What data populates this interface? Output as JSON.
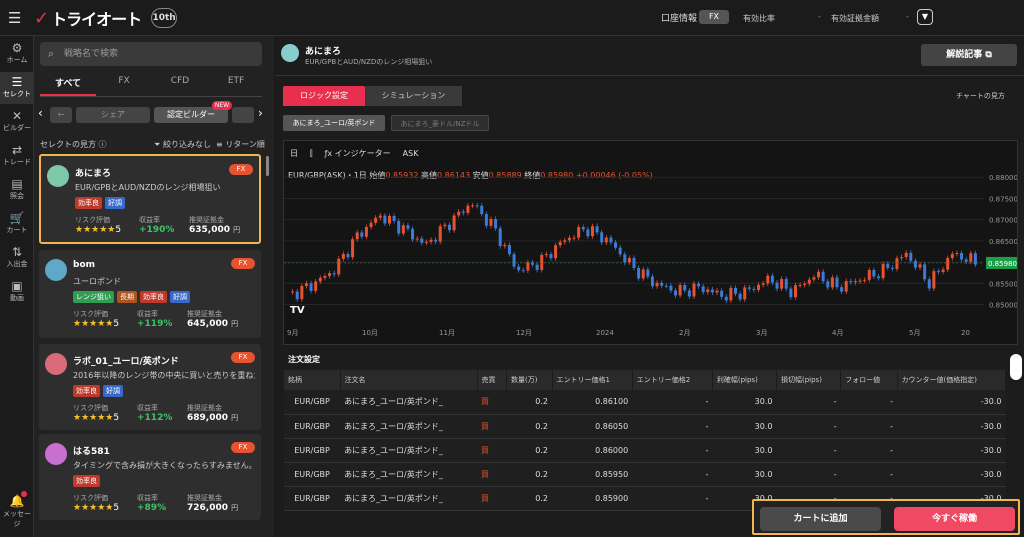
{
  "topbar": {
    "menu_icon": "hamburger-icon",
    "brand": "トライオート",
    "anniversary": "10th",
    "account_info": "口座情報",
    "account_type": "FX",
    "effective_ratio_label": "有効比率",
    "effective_ratio_sep": "-",
    "effective_margin_label": "有効証拠金額",
    "effective_margin_sep": "-"
  },
  "nav": [
    {
      "label": "ホーム",
      "icon": "gear-icon"
    },
    {
      "label": "セレクト",
      "icon": "stack-icon"
    },
    {
      "label": "ビルダー",
      "icon": "tools-icon"
    },
    {
      "label": "トレード",
      "icon": "trade-icon"
    },
    {
      "label": "照会",
      "icon": "list-icon"
    },
    {
      "label": "カート",
      "icon": "cart-icon"
    },
    {
      "label": "入出金",
      "icon": "transfer-icon"
    },
    {
      "label": "動画",
      "icon": "video-icon"
    }
  ],
  "messages": {
    "label": "メッセージ"
  },
  "sidebar": {
    "search_placeholder": "戦略名で検索",
    "tabs": [
      "すべて",
      "FX",
      "CFD",
      "ETF"
    ],
    "chips": [
      "シェア",
      "認定ビルダー"
    ],
    "chip_new": "NEW",
    "select_how": "セレクトの見方",
    "filter": "絞り込みなし",
    "sort": "リターン順"
  },
  "cards": [
    {
      "name": "あにまろ",
      "badge": "FX",
      "desc": "EUR/GPBとAUD/NZDのレンジ相場狙い",
      "tags": [
        "効率良",
        "好調"
      ],
      "risk_label": "リスク評価",
      "stars": "★★★★★",
      "risk": "5",
      "gain_label": "収益率",
      "gain": "+190%",
      "margin_label": "推奨証拠金",
      "margin": "635,000",
      "unit": "円"
    },
    {
      "name": "bom",
      "badge": "FX",
      "desc": "ユーロポンド",
      "tags": [
        "レンジ狙い",
        "長期",
        "効率良",
        "好調"
      ],
      "risk_label": "リスク評価",
      "stars": "★★★★★",
      "risk": "5",
      "gain_label": "収益率",
      "gain": "+119%",
      "margin_label": "推奨証拠金",
      "margin": "645,000",
      "unit": "円"
    },
    {
      "name": "ラボ_01_ユーロ/英ポンド",
      "badge": "FX",
      "desc": "2016年以降のレンジ帯の中央に買いと売りを重ねた設...",
      "tags": [
        "効率良",
        "好調"
      ],
      "risk_label": "リスク評価",
      "stars": "★★★★★",
      "risk": "5",
      "gain_label": "収益率",
      "gain": "+112%",
      "margin_label": "推奨証拠金",
      "margin": "689,000",
      "unit": "円"
    },
    {
      "name": "はる581",
      "badge": "FX",
      "desc": "タイミングで含み損が大きくなったらすみません。よ...",
      "tags": [
        "効率良"
      ],
      "risk_label": "リスク評価",
      "stars": "★★★★★",
      "risk": "5",
      "gain_label": "収益率",
      "gain": "+89%",
      "margin_label": "推奨証拠金",
      "margin": "726,000",
      "unit": "円"
    }
  ],
  "main": {
    "name": "あにまろ",
    "desc": "EUR/GPBとAUD/NZDのレンジ相場狙い",
    "explain_btn": "解説記事",
    "tab_logic": "ロジック設定",
    "tab_sim": "シミュレーション",
    "chart_how": "チャートの見方",
    "strategy1": "あにまろ_ユーロ/英ポンド",
    "strategy2": "あにまろ_豪ドル/NZドル",
    "tools": {
      "interval": "日",
      "indicator": "インジケーター",
      "side": "ASK"
    },
    "legend": {
      "symbol": "EUR/GBP(ASK)・1日",
      "o_label": "始値",
      "o": "0.85932",
      "h_label": "高値",
      "h": "0.86143",
      "l_label": "安値",
      "l": "0.85889",
      "c_label": "終値",
      "c": "0.85980",
      "chg": "+0.00046 (-0.05%)"
    },
    "order_title": "注文設定",
    "order_headers": [
      "銘柄",
      "注文名",
      "売買",
      "数量(万)",
      "エントリー価格1",
      "エントリー価格2",
      "利確幅(pips)",
      "損切幅(pips)",
      "フォロー値",
      "カウンター値(価格指定)"
    ],
    "order_rows": [
      [
        "EUR/GBP",
        "あにまろ_ユーロ/英ポンド_",
        "買",
        "0.2",
        "0.86100",
        "-",
        "30.0",
        "-",
        "-",
        "-30.0"
      ],
      [
        "EUR/GBP",
        "あにまろ_ユーロ/英ポンド_",
        "買",
        "0.2",
        "0.86050",
        "-",
        "30.0",
        "-",
        "-",
        "-30.0"
      ],
      [
        "EUR/GBP",
        "あにまろ_ユーロ/英ポンド_",
        "買",
        "0.2",
        "0.86000",
        "-",
        "30.0",
        "-",
        "-",
        "-30.0"
      ],
      [
        "EUR/GBP",
        "あにまろ_ユーロ/英ポンド_",
        "買",
        "0.2",
        "0.85950",
        "-",
        "30.0",
        "-",
        "-",
        "-30.0"
      ],
      [
        "EUR/GBP",
        "あにまろ_ユーロ/英ポンド_",
        "買",
        "0.2",
        "0.85900",
        "-",
        "30.0",
        "-",
        "-",
        "-30.0"
      ]
    ],
    "cart_btn": "カートに追加",
    "run_btn": "今すぐ稼働"
  },
  "colors": {
    "accent": "#e8304e",
    "up": "#e85230",
    "down": "#3d7bd9",
    "gain": "#3ec26a",
    "highlight": "#f2b64b"
  },
  "chart_data": {
    "type": "candlestick",
    "x_ticks": [
      "9月",
      "10月",
      "11月",
      "12月",
      "2024",
      "2月",
      "3月",
      "4月",
      "5月",
      "20"
    ],
    "y_ticks": [
      0.88,
      0.875,
      0.87,
      0.865,
      0.86,
      0.855,
      0.85
    ],
    "last_price": "0.85980",
    "ylim": [
      0.848,
      0.881
    ]
  }
}
